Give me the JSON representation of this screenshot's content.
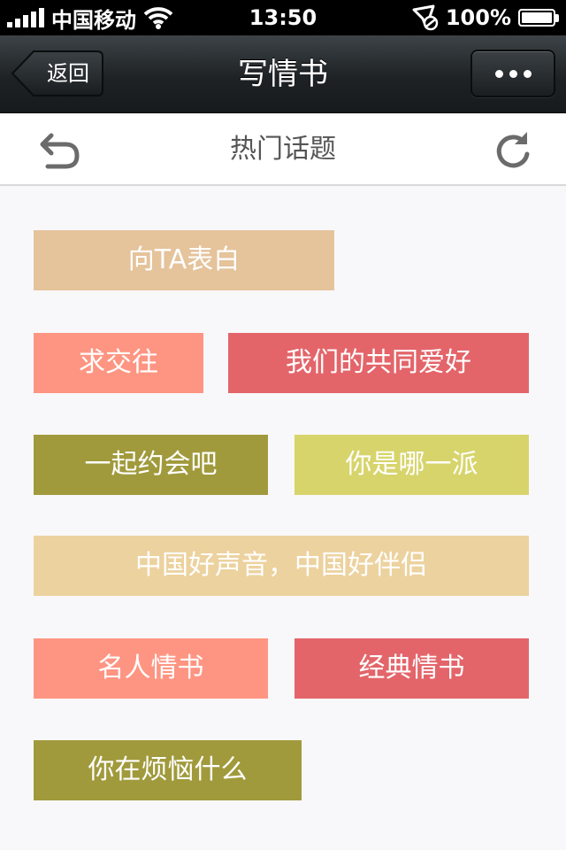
{
  "status_bar": {
    "carrier": "中国移动",
    "time": "13:50",
    "battery": "100%",
    "icons": [
      "signal-icon",
      "wifi-icon",
      "location-lock-icon",
      "battery-icon"
    ]
  },
  "nav": {
    "back_label": "返回",
    "title": "写情书",
    "more_icon": "more-dots-icon"
  },
  "toolbar": {
    "title": "热门话题",
    "left_icon": "undo-icon",
    "right_icon": "refresh-icon"
  },
  "colors": {
    "peach": "#e5c39b",
    "salmon": "#fe9582",
    "red": "#e3656a",
    "olive": "#a09a3c",
    "yellow": "#d7d46c",
    "sand": "#ecd29f"
  },
  "topics": [
    {
      "label": "向TA表白",
      "color": "#e5c39b"
    },
    {
      "label": "求交往",
      "color": "#fe9582"
    },
    {
      "label": "我们的共同爱好",
      "color": "#e3656a"
    },
    {
      "label": "一起约会吧",
      "color": "#a09a3c"
    },
    {
      "label": "你是哪一派",
      "color": "#d7d46c"
    },
    {
      "label": "中国好声音，中国好伴侣",
      "color": "#ecd29f"
    },
    {
      "label": "名人情书",
      "color": "#fe9582"
    },
    {
      "label": "经典情书",
      "color": "#e3656a"
    },
    {
      "label": "你在烦恼什么",
      "color": "#a09a3c"
    }
  ]
}
